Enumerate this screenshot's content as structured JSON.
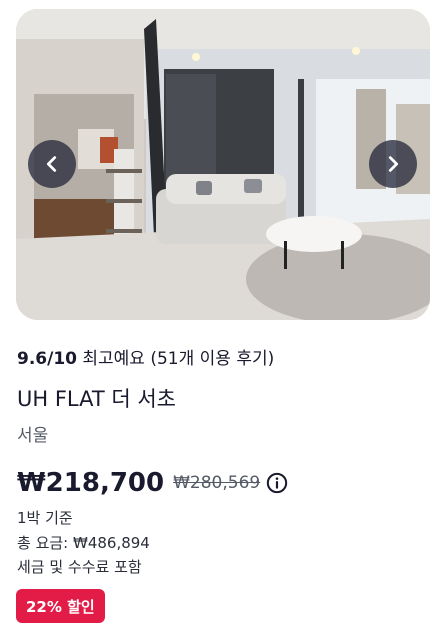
{
  "listing": {
    "rating_score": "9.6/10",
    "rating_text": "최고예요 (51개 이용 후기)",
    "name": "UH FLAT 더 서초",
    "city": "서울",
    "price": "₩218,700",
    "original_price": "₩280,569",
    "per_night": "1박 기준",
    "total_price": "총 요금: ₩486,894",
    "tax_note": "세금 및 수수료 포함",
    "discount_badge": "22% 할인"
  },
  "icons": {
    "prev": "chevron-left-icon",
    "next": "chevron-right-icon",
    "info": "info-circle-icon"
  },
  "colors": {
    "badge_bg": "#e31b47",
    "text": "#1a1a2e",
    "nav_button_bg": "#282c3e"
  }
}
